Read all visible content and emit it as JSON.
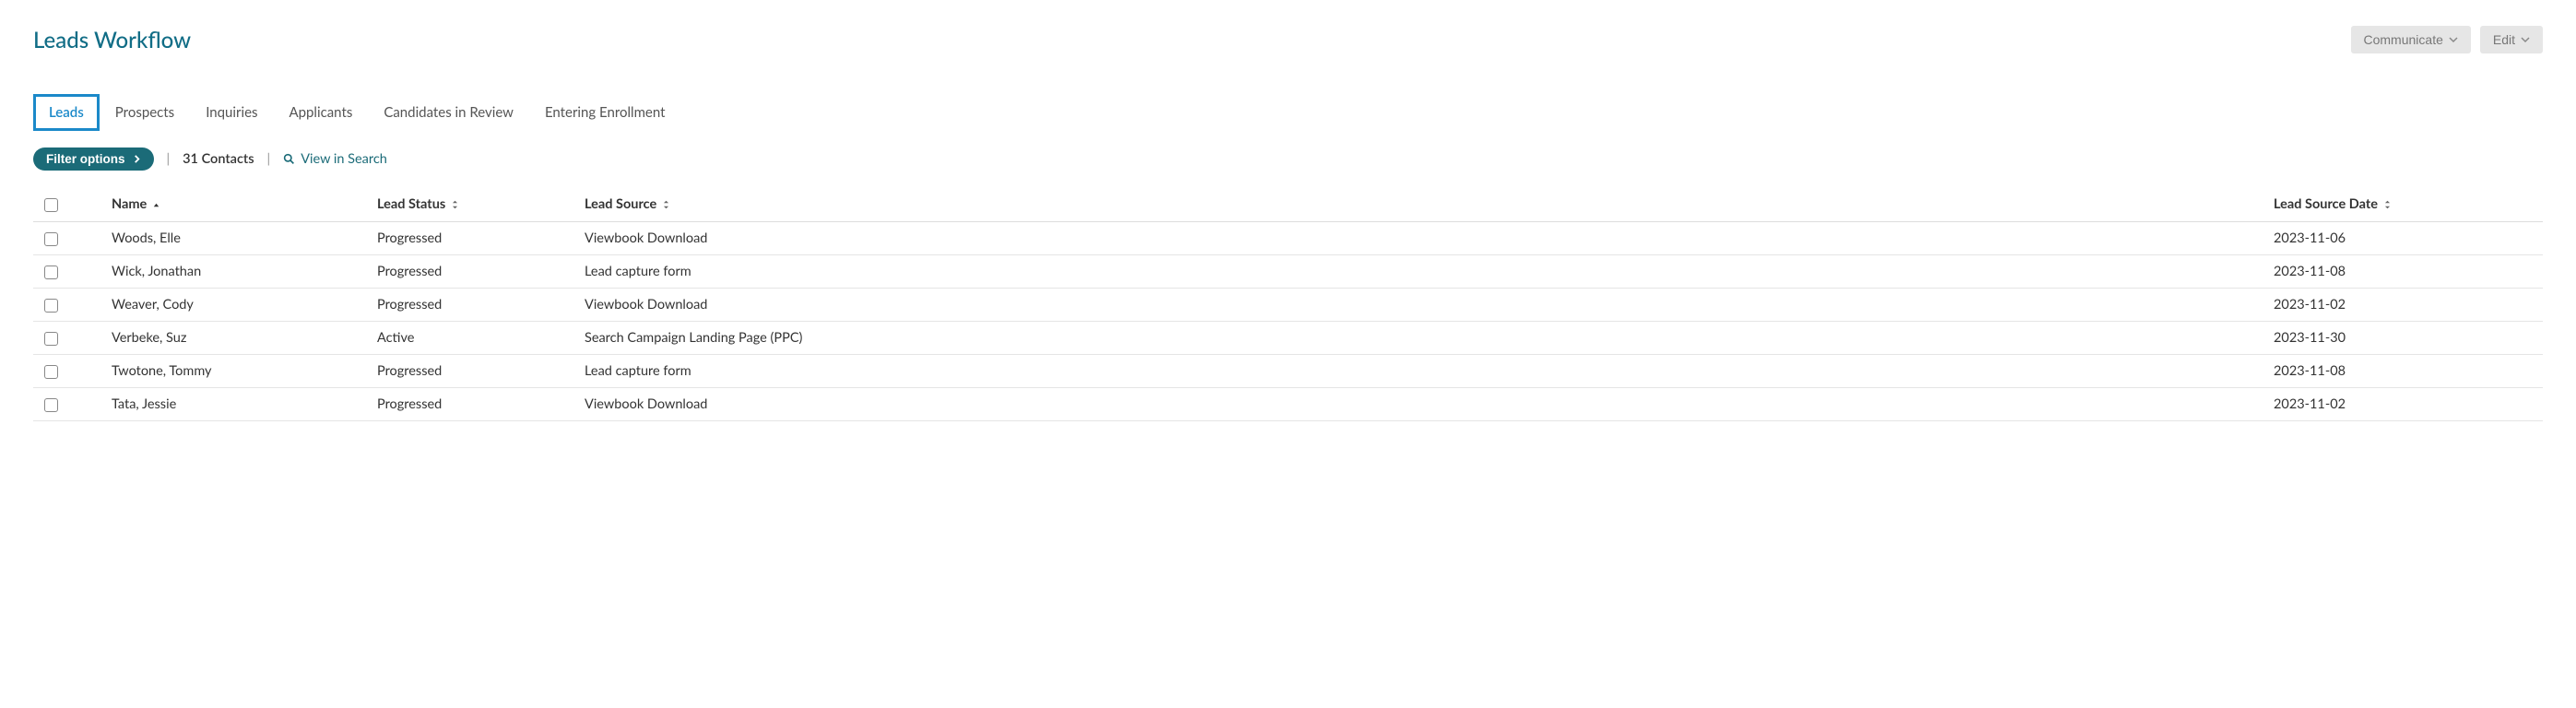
{
  "header": {
    "title": "Leads Workflow",
    "communicate_label": "Communicate",
    "edit_label": "Edit"
  },
  "tabs": [
    {
      "label": "Leads",
      "active": true
    },
    {
      "label": "Prospects",
      "active": false
    },
    {
      "label": "Inquiries",
      "active": false
    },
    {
      "label": "Applicants",
      "active": false
    },
    {
      "label": "Candidates in Review",
      "active": false
    },
    {
      "label": "Entering Enrollment",
      "active": false
    }
  ],
  "subbar": {
    "filter_label": "Filter options",
    "contact_count": "31 Contacts",
    "view_in_search_label": "View in Search"
  },
  "columns": {
    "name": "Name",
    "status": "Lead Status",
    "source": "Lead Source",
    "date": "Lead Source Date"
  },
  "rows": [
    {
      "name": "Woods, Elle",
      "status": "Progressed",
      "source": "Viewbook Download",
      "date": "2023-11-06"
    },
    {
      "name": "Wick, Jonathan",
      "status": "Progressed",
      "source": "Lead capture form",
      "date": "2023-11-08"
    },
    {
      "name": "Weaver, Cody",
      "status": "Progressed",
      "source": "Viewbook Download",
      "date": "2023-11-02"
    },
    {
      "name": "Verbeke, Suz",
      "status": "Active",
      "source": "Search Campaign Landing Page (PPC)",
      "date": "2023-11-30"
    },
    {
      "name": "Twotone, Tommy",
      "status": "Progressed",
      "source": "Lead capture form",
      "date": "2023-11-08"
    },
    {
      "name": "Tata, Jessie",
      "status": "Progressed",
      "source": "Viewbook Download",
      "date": "2023-11-02"
    }
  ]
}
